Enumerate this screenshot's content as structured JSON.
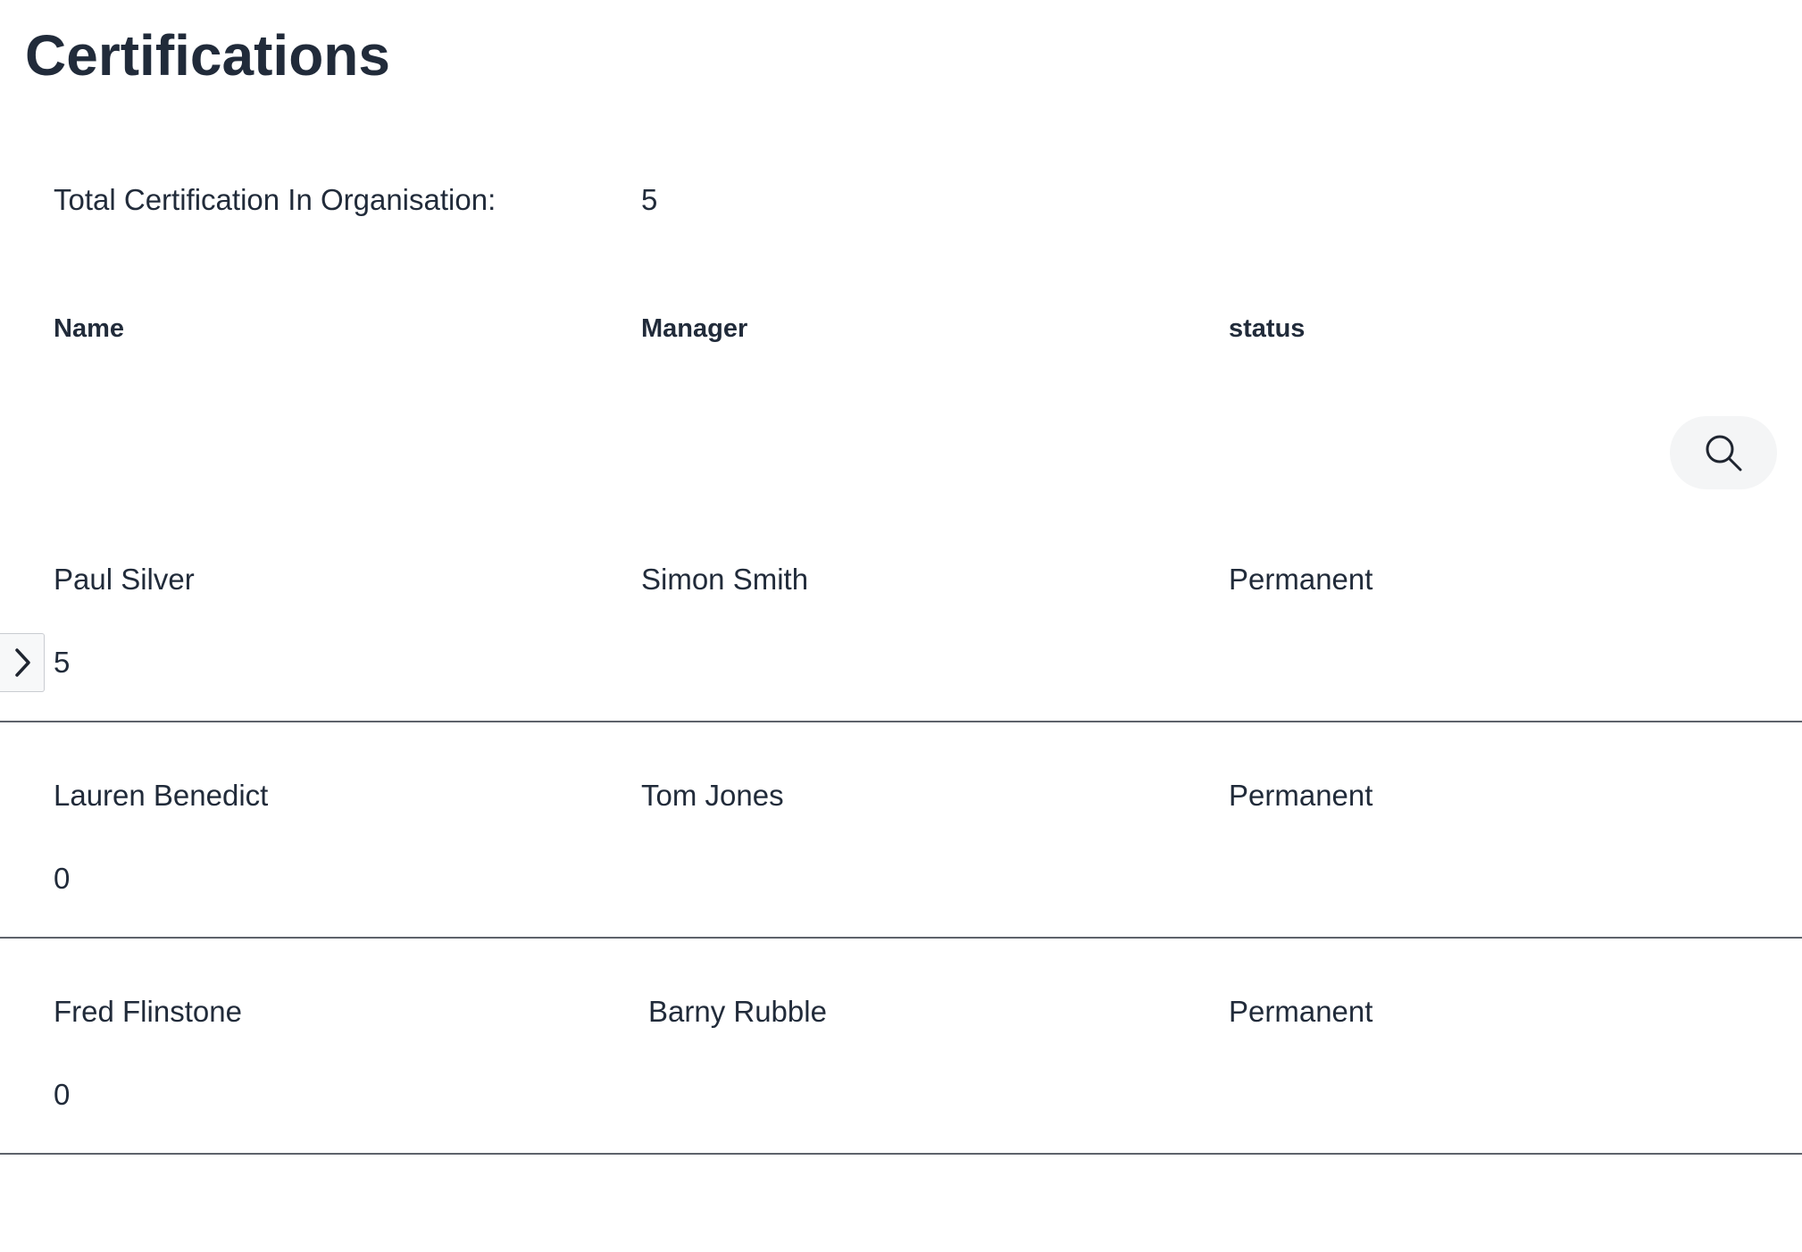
{
  "page": {
    "title": "Certifications"
  },
  "summary": {
    "label": "Total Certification In Organisation:",
    "value": "5"
  },
  "table": {
    "columns": [
      "Name",
      "Manager",
      "status"
    ],
    "rows": [
      {
        "name": "Paul Silver",
        "manager": "Simon Smith",
        "status": "Permanent",
        "count": "5"
      },
      {
        "name": "Lauren Benedict",
        "manager": "Tom Jones",
        "status": "Permanent",
        "count": "0"
      },
      {
        "name": "Fred Flinstone",
        "manager": "Barny Rubble",
        "status": "Permanent",
        "count": "0"
      }
    ]
  },
  "icons": {
    "search": "search-icon",
    "expand": "chevron-right-icon"
  },
  "colors": {
    "text": "#212b3a",
    "divider": "#5e636b",
    "search_button_bg": "#f4f5f6"
  }
}
